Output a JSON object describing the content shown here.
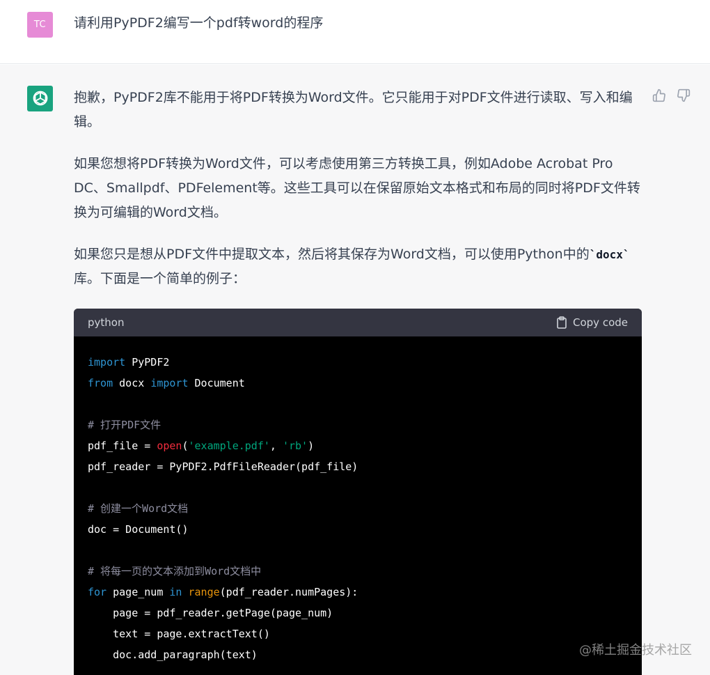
{
  "user": {
    "avatar_text": "TC",
    "avatar_color": "#e68bd6",
    "message": "请利用PyPDF2编写一个pdf转word的程序"
  },
  "assistant": {
    "avatar_icon": "openai-logo-icon",
    "avatar_color": "#19a37f",
    "feedback": {
      "up_icon": "thumbs-up-icon",
      "down_icon": "thumbs-down-icon"
    },
    "p1": "抱歉，PyPDF2库不能用于将PDF转换为Word文件。它只能用于对PDF文件进行读取、写入和编辑。",
    "p2": "如果您想将PDF转换为Word文件，可以考虑使用第三方转换工具，例如Adobe Acrobat Pro DC、Smallpdf、PDFelement等。这些工具可以在保留原始文本格式和布局的同时将PDF文件转换为可编辑的Word文档。",
    "p3_before": "如果您只是想从PDF文件中提取文本，然后将其保存为Word文档，可以使用Python中的",
    "p3_code": "`docx`",
    "p3_after": "库。下面是一个简单的例子："
  },
  "code_block": {
    "language": "python",
    "copy_label": "Copy code",
    "copy_icon": "clipboard-icon",
    "lines": [
      "import PyPDF2",
      "from docx import Document",
      "",
      "# 打开PDF文件",
      "pdf_file = open('example.pdf', 'rb')",
      "pdf_reader = PyPDF2.PdfFileReader(pdf_file)",
      "",
      "# 创建一个Word文档",
      "doc = Document()",
      "",
      "# 将每一页的文本添加到Word文档中",
      "for page_num in range(pdf_reader.numPages):",
      "    page = pdf_reader.getPage(page_num)",
      "    text = page.extractText()",
      "    doc.add_paragraph(text)"
    ]
  },
  "watermark": "@稀土掘金技术社区"
}
